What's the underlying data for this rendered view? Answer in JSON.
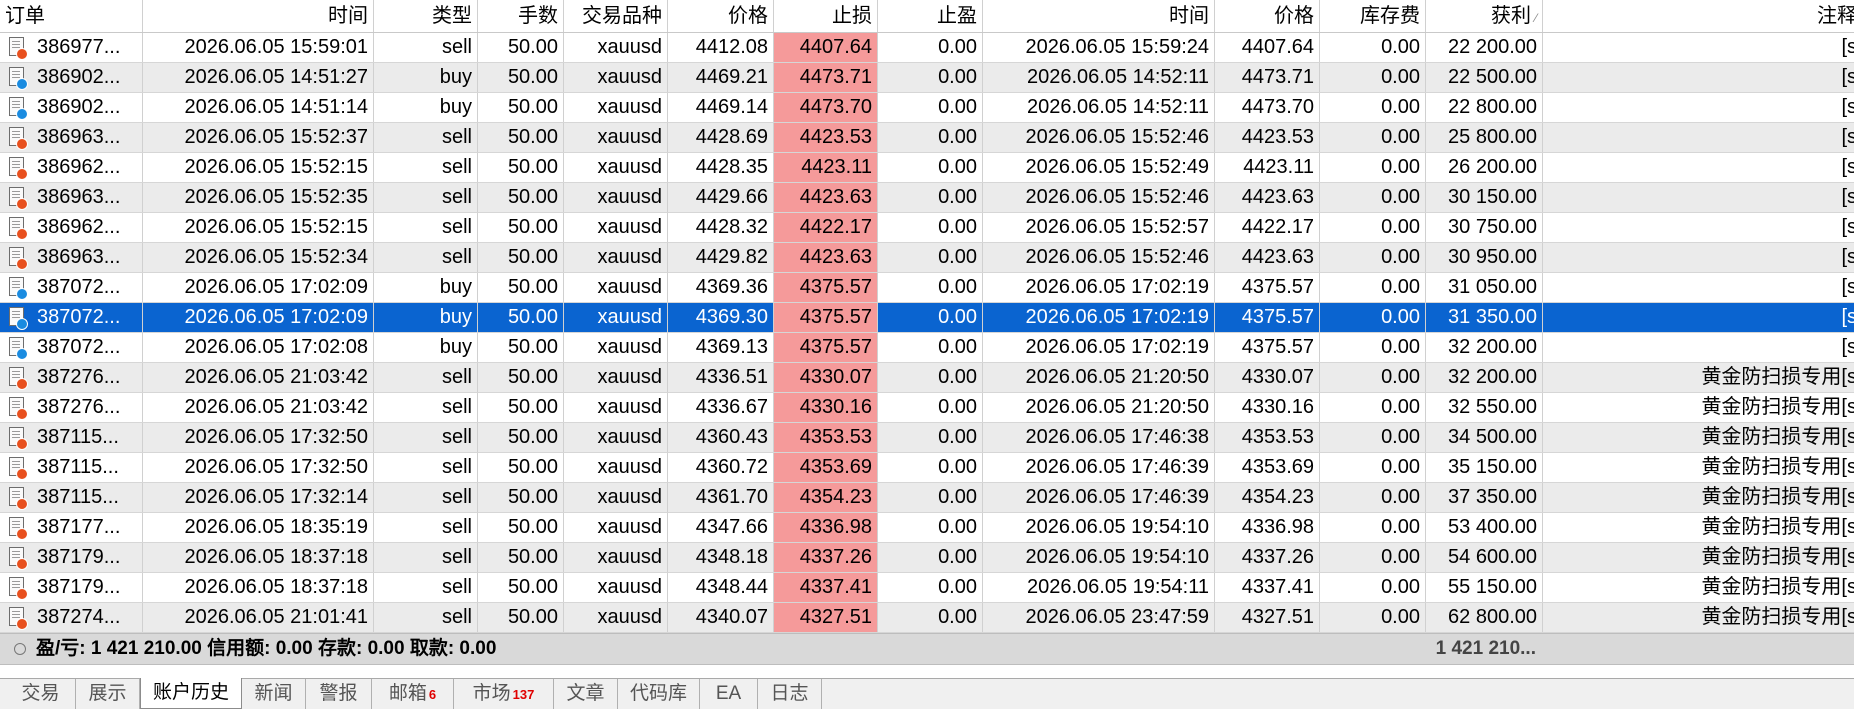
{
  "colors": {
    "selected_row": "#0a64d0",
    "stop_loss_cell": "#f59a9a",
    "sell_marker": "#e8501e",
    "buy_marker": "#1a8be0",
    "badge": "#e00000"
  },
  "columns": [
    {
      "key": "order",
      "label": "订单"
    },
    {
      "key": "open_time",
      "label": "时间"
    },
    {
      "key": "type",
      "label": "类型"
    },
    {
      "key": "volume",
      "label": "手数"
    },
    {
      "key": "symbol",
      "label": "交易品种"
    },
    {
      "key": "open_price",
      "label": "价格"
    },
    {
      "key": "sl",
      "label": "止损"
    },
    {
      "key": "tp",
      "label": "止盈"
    },
    {
      "key": "close_time",
      "label": "时间"
    },
    {
      "key": "close_price",
      "label": "价格"
    },
    {
      "key": "swap",
      "label": "库存费"
    },
    {
      "key": "profit",
      "label": "获利"
    },
    {
      "key": "comment",
      "label": "注释"
    }
  ],
  "rows": [
    {
      "order": "386977...",
      "open_time": "2026.06.05 15:59:01",
      "type": "sell",
      "volume": "50.00",
      "symbol": "xauusd",
      "open_price": "4412.08",
      "sl": "4407.64",
      "tp": "0.00",
      "close_time": "2026.06.05 15:59:24",
      "close_price": "4407.64",
      "swap": "0.00",
      "profit": "22 200.00",
      "comment": "[s"
    },
    {
      "order": "386902...",
      "open_time": "2026.06.05 14:51:27",
      "type": "buy",
      "volume": "50.00",
      "symbol": "xauusd",
      "open_price": "4469.21",
      "sl": "4473.71",
      "tp": "0.00",
      "close_time": "2026.06.05 14:52:11",
      "close_price": "4473.71",
      "swap": "0.00",
      "profit": "22 500.00",
      "comment": "[s"
    },
    {
      "order": "386902...",
      "open_time": "2026.06.05 14:51:14",
      "type": "buy",
      "volume": "50.00",
      "symbol": "xauusd",
      "open_price": "4469.14",
      "sl": "4473.70",
      "tp": "0.00",
      "close_time": "2026.06.05 14:52:11",
      "close_price": "4473.70",
      "swap": "0.00",
      "profit": "22 800.00",
      "comment": "[s"
    },
    {
      "order": "386963...",
      "open_time": "2026.06.05 15:52:37",
      "type": "sell",
      "volume": "50.00",
      "symbol": "xauusd",
      "open_price": "4428.69",
      "sl": "4423.53",
      "tp": "0.00",
      "close_time": "2026.06.05 15:52:46",
      "close_price": "4423.53",
      "swap": "0.00",
      "profit": "25 800.00",
      "comment": "[s"
    },
    {
      "order": "386962...",
      "open_time": "2026.06.05 15:52:15",
      "type": "sell",
      "volume": "50.00",
      "symbol": "xauusd",
      "open_price": "4428.35",
      "sl": "4423.11",
      "tp": "0.00",
      "close_time": "2026.06.05 15:52:49",
      "close_price": "4423.11",
      "swap": "0.00",
      "profit": "26 200.00",
      "comment": "[s"
    },
    {
      "order": "386963...",
      "open_time": "2026.06.05 15:52:35",
      "type": "sell",
      "volume": "50.00",
      "symbol": "xauusd",
      "open_price": "4429.66",
      "sl": "4423.63",
      "tp": "0.00",
      "close_time": "2026.06.05 15:52:46",
      "close_price": "4423.63",
      "swap": "0.00",
      "profit": "30 150.00",
      "comment": "[s"
    },
    {
      "order": "386962...",
      "open_time": "2026.06.05 15:52:15",
      "type": "sell",
      "volume": "50.00",
      "symbol": "xauusd",
      "open_price": "4428.32",
      "sl": "4422.17",
      "tp": "0.00",
      "close_time": "2026.06.05 15:52:57",
      "close_price": "4422.17",
      "swap": "0.00",
      "profit": "30 750.00",
      "comment": "[s"
    },
    {
      "order": "386963...",
      "open_time": "2026.06.05 15:52:34",
      "type": "sell",
      "volume": "50.00",
      "symbol": "xauusd",
      "open_price": "4429.82",
      "sl": "4423.63",
      "tp": "0.00",
      "close_time": "2026.06.05 15:52:46",
      "close_price": "4423.63",
      "swap": "0.00",
      "profit": "30 950.00",
      "comment": "[s"
    },
    {
      "order": "387072...",
      "open_time": "2026.06.05 17:02:09",
      "type": "buy",
      "volume": "50.00",
      "symbol": "xauusd",
      "open_price": "4369.36",
      "sl": "4375.57",
      "tp": "0.00",
      "close_time": "2026.06.05 17:02:19",
      "close_price": "4375.57",
      "swap": "0.00",
      "profit": "31 050.00",
      "comment": "[s"
    },
    {
      "order": "387072...",
      "open_time": "2026.06.05 17:02:09",
      "type": "buy",
      "volume": "50.00",
      "symbol": "xauusd",
      "open_price": "4369.30",
      "sl": "4375.57",
      "tp": "0.00",
      "close_time": "2026.06.05 17:02:19",
      "close_price": "4375.57",
      "swap": "0.00",
      "profit": "31 350.00",
      "comment": "[s",
      "selected": true
    },
    {
      "order": "387072...",
      "open_time": "2026.06.05 17:02:08",
      "type": "buy",
      "volume": "50.00",
      "symbol": "xauusd",
      "open_price": "4369.13",
      "sl": "4375.57",
      "tp": "0.00",
      "close_time": "2026.06.05 17:02:19",
      "close_price": "4375.57",
      "swap": "0.00",
      "profit": "32 200.00",
      "comment": "[s"
    },
    {
      "order": "387276...",
      "open_time": "2026.06.05 21:03:42",
      "type": "sell",
      "volume": "50.00",
      "symbol": "xauusd",
      "open_price": "4336.51",
      "sl": "4330.07",
      "tp": "0.00",
      "close_time": "2026.06.05 21:20:50",
      "close_price": "4330.07",
      "swap": "0.00",
      "profit": "32 200.00",
      "comment": "黄金防扫损专用[s"
    },
    {
      "order": "387276...",
      "open_time": "2026.06.05 21:03:42",
      "type": "sell",
      "volume": "50.00",
      "symbol": "xauusd",
      "open_price": "4336.67",
      "sl": "4330.16",
      "tp": "0.00",
      "close_time": "2026.06.05 21:20:50",
      "close_price": "4330.16",
      "swap": "0.00",
      "profit": "32 550.00",
      "comment": "黄金防扫损专用[s"
    },
    {
      "order": "387115...",
      "open_time": "2026.06.05 17:32:50",
      "type": "sell",
      "volume": "50.00",
      "symbol": "xauusd",
      "open_price": "4360.43",
      "sl": "4353.53",
      "tp": "0.00",
      "close_time": "2026.06.05 17:46:38",
      "close_price": "4353.53",
      "swap": "0.00",
      "profit": "34 500.00",
      "comment": "黄金防扫损专用[s"
    },
    {
      "order": "387115...",
      "open_time": "2026.06.05 17:32:50",
      "type": "sell",
      "volume": "50.00",
      "symbol": "xauusd",
      "open_price": "4360.72",
      "sl": "4353.69",
      "tp": "0.00",
      "close_time": "2026.06.05 17:46:39",
      "close_price": "4353.69",
      "swap": "0.00",
      "profit": "35 150.00",
      "comment": "黄金防扫损专用[s"
    },
    {
      "order": "387115...",
      "open_time": "2026.06.05 17:32:14",
      "type": "sell",
      "volume": "50.00",
      "symbol": "xauusd",
      "open_price": "4361.70",
      "sl": "4354.23",
      "tp": "0.00",
      "close_time": "2026.06.05 17:46:39",
      "close_price": "4354.23",
      "swap": "0.00",
      "profit": "37 350.00",
      "comment": "黄金防扫损专用[s"
    },
    {
      "order": "387177...",
      "open_time": "2026.06.05 18:35:19",
      "type": "sell",
      "volume": "50.00",
      "symbol": "xauusd",
      "open_price": "4347.66",
      "sl": "4336.98",
      "tp": "0.00",
      "close_time": "2026.06.05 19:54:10",
      "close_price": "4336.98",
      "swap": "0.00",
      "profit": "53 400.00",
      "comment": "黄金防扫损专用[s"
    },
    {
      "order": "387179...",
      "open_time": "2026.06.05 18:37:18",
      "type": "sell",
      "volume": "50.00",
      "symbol": "xauusd",
      "open_price": "4348.18",
      "sl": "4337.26",
      "tp": "0.00",
      "close_time": "2026.06.05 19:54:10",
      "close_price": "4337.26",
      "swap": "0.00",
      "profit": "54 600.00",
      "comment": "黄金防扫损专用[s"
    },
    {
      "order": "387179...",
      "open_time": "2026.06.05 18:37:18",
      "type": "sell",
      "volume": "50.00",
      "symbol": "xauusd",
      "open_price": "4348.44",
      "sl": "4337.41",
      "tp": "0.00",
      "close_time": "2026.06.05 19:54:11",
      "close_price": "4337.41",
      "swap": "0.00",
      "profit": "55 150.00",
      "comment": "黄金防扫损专用[s"
    },
    {
      "order": "387274...",
      "open_time": "2026.06.05 21:01:41",
      "type": "sell",
      "volume": "50.00",
      "symbol": "xauusd",
      "open_price": "4340.07",
      "sl": "4327.51",
      "tp": "0.00",
      "close_time": "2026.06.05 23:47:59",
      "close_price": "4327.51",
      "swap": "0.00",
      "profit": "62 800.00",
      "comment": "黄金防扫损专用[s"
    }
  ],
  "summary": {
    "text": "盈/亏: 1 421 210.00  信用额: 0.00  存款: 0.00  取款: 0.00",
    "total": "1 421 210..."
  },
  "tabs": [
    {
      "label": "交易"
    },
    {
      "label": "展示"
    },
    {
      "label": "账户历史",
      "active": true
    },
    {
      "label": "新闻"
    },
    {
      "label": "警报"
    },
    {
      "label": "邮箱",
      "badge": "6"
    },
    {
      "label": "市场",
      "badge": "137"
    },
    {
      "label": "文章"
    },
    {
      "label": "代码库"
    },
    {
      "label": "EA"
    },
    {
      "label": "日志"
    }
  ]
}
